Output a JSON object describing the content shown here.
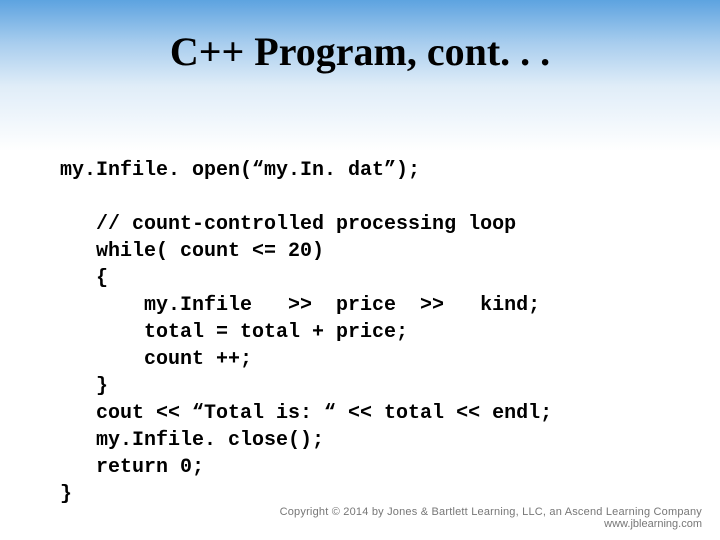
{
  "title": "C++ Program, cont. . .",
  "code": {
    "l1": "my.Infile. open(“my.In. dat”);",
    "l2": "",
    "l3": "   // count-controlled processing loop",
    "l4": "   while( count <= 20)",
    "l5": "   {",
    "l6": "       my.Infile   >>  price  >>   kind;",
    "l7": "       total = total + price;",
    "l8": "       count ++;",
    "l9": "   }",
    "l10": "   cout << “Total is: “ << total << endl;",
    "l11": "   my.Infile. close();",
    "l12": "   return 0;",
    "l13": "}"
  },
  "footer": {
    "copyright": "Copyright © 2014 by Jones & Bartlett Learning, LLC, an Ascend Learning Company",
    "url": "www.jblearning.com"
  }
}
